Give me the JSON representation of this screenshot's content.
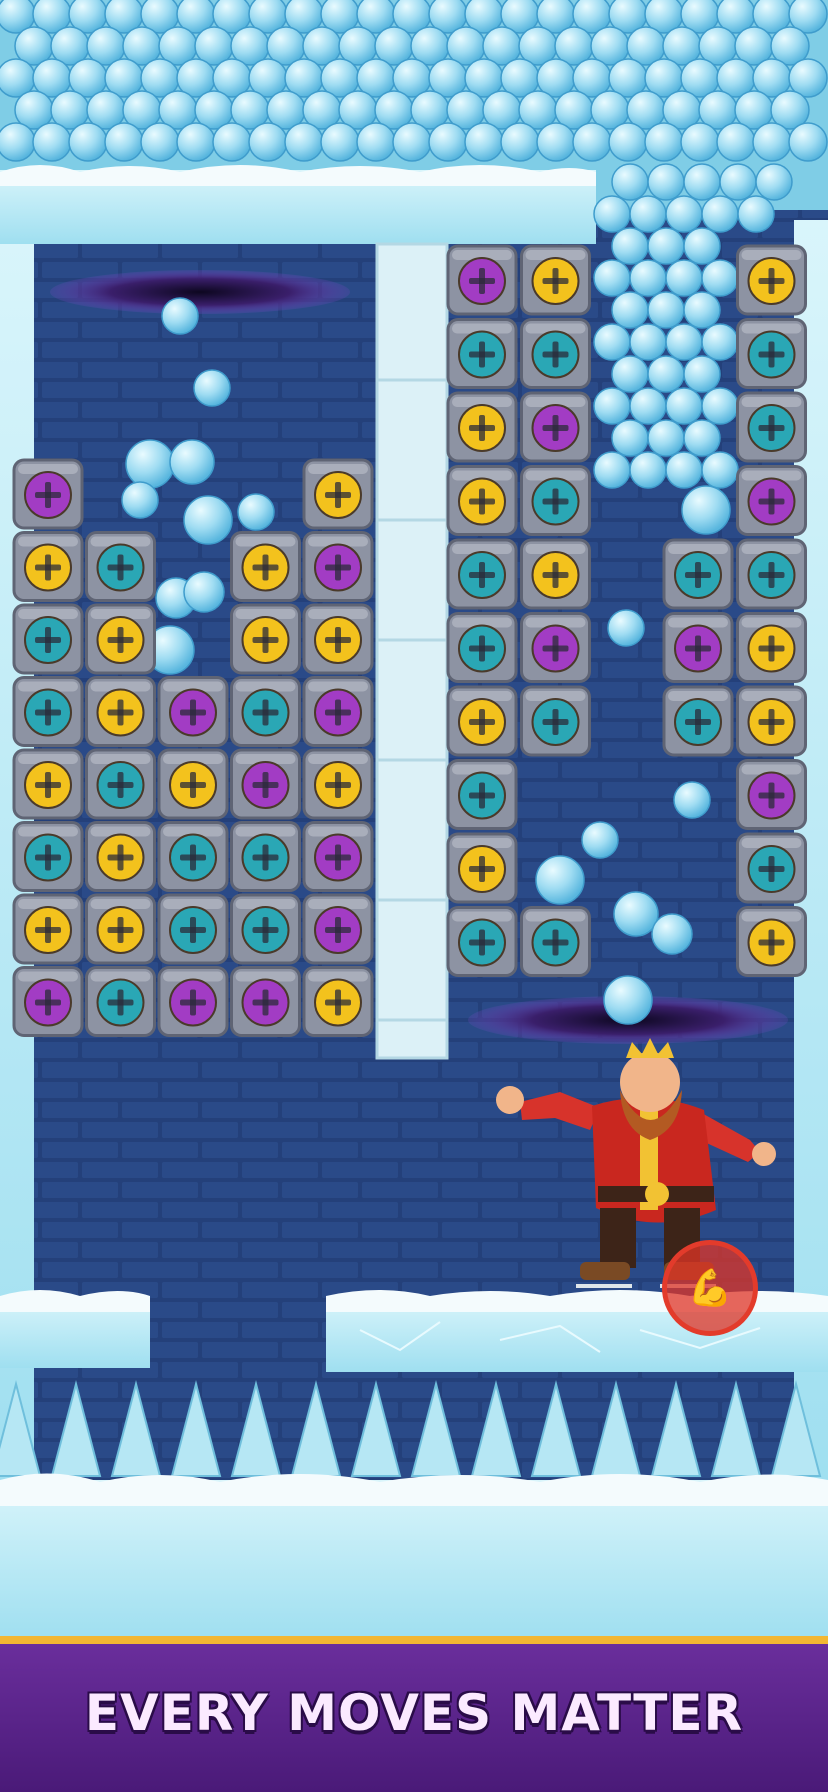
{
  "tagline": "EVERY MOVES MATTER",
  "colors": {
    "wall": "#24407a",
    "brick_line": "#17284f",
    "ice": "#bde9f4",
    "snow": "#f4fbfd",
    "screw_yellow": "#f3c21d",
    "screw_teal": "#2aa7b5",
    "screw_purple": "#a23cc4",
    "block": "#8d93a3",
    "portal": "#3a1f6b",
    "banner": "#5a2388",
    "banner_border": "#f3b733"
  },
  "icons": {
    "strength_badge": "flexed-arm-icon",
    "character": "king-skater",
    "portal": "purple-portal"
  },
  "grid_left": [
    [
      "purple",
      null,
      null,
      null,
      "yellow"
    ],
    [
      "yellow",
      "teal",
      null,
      "yellow",
      "purple"
    ],
    [
      "teal",
      "yellow",
      null,
      "yellow",
      "yellow"
    ],
    [
      "teal",
      "yellow",
      "purple",
      "teal",
      "purple"
    ],
    [
      "yellow",
      "teal",
      "yellow",
      "purple",
      "yellow"
    ],
    [
      "teal",
      "yellow",
      "teal",
      "teal",
      "purple"
    ],
    [
      "yellow",
      "yellow",
      "teal",
      "teal",
      "purple"
    ],
    [
      "purple",
      "teal",
      "purple",
      "purple",
      "yellow"
    ]
  ],
  "grid_mid": [
    [
      "purple",
      "yellow"
    ],
    [
      "teal",
      "teal"
    ],
    [
      "yellow",
      "purple"
    ],
    [
      "yellow",
      "teal"
    ],
    [
      "teal",
      "yellow"
    ],
    [
      "teal",
      "purple"
    ],
    [
      "yellow",
      "teal"
    ],
    [
      "teal",
      null
    ],
    [
      "yellow",
      null
    ],
    [
      "teal",
      "teal"
    ]
  ],
  "grid_right": [
    [
      null,
      "yellow"
    ],
    [
      null,
      "teal"
    ],
    [
      null,
      "teal"
    ],
    [
      null,
      "purple"
    ],
    [
      "teal",
      "teal"
    ],
    [
      "purple",
      "yellow"
    ],
    [
      "teal",
      "yellow"
    ],
    [
      null,
      "purple"
    ],
    [
      null,
      "teal"
    ],
    [
      null,
      "yellow"
    ]
  ]
}
